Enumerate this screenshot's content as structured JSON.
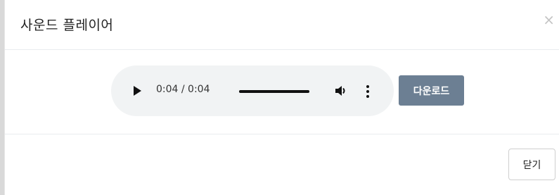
{
  "modal": {
    "title": "사운드 플레이어",
    "close_symbol": "×"
  },
  "audio_player": {
    "play_icon": "play-icon",
    "time_display": "0:04 / 0:04",
    "progress_fraction": 1.0,
    "volume_icon": "volume-icon",
    "more_icon": "more-options-icon"
  },
  "download_button": {
    "label": "다운로드",
    "color": "#6c7f93"
  },
  "footer": {
    "close_label": "닫기"
  }
}
